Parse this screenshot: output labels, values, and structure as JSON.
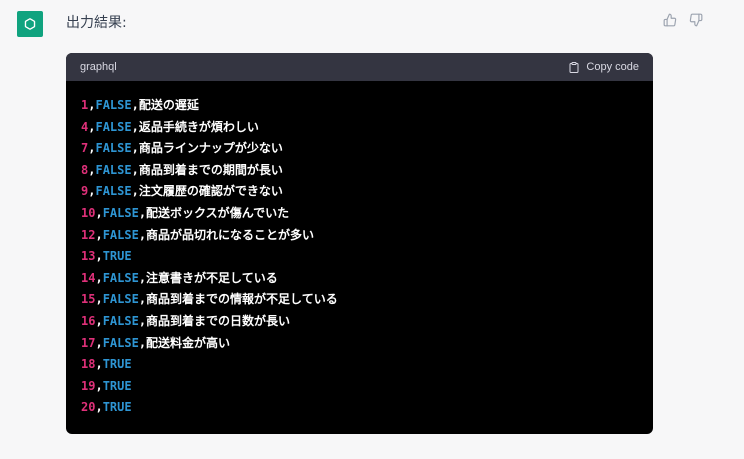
{
  "message": {
    "intro": "出力結果:"
  },
  "code_block": {
    "language": "graphql",
    "copy_label": "Copy code",
    "lines": [
      {
        "num": "1",
        "bool": "FALSE",
        "text": "配送の遅延"
      },
      {
        "num": "4",
        "bool": "FALSE",
        "text": "返品手続きが煩わしい"
      },
      {
        "num": "7",
        "bool": "FALSE",
        "text": "商品ラインナップが少ない"
      },
      {
        "num": "8",
        "bool": "FALSE",
        "text": "商品到着までの期間が長い"
      },
      {
        "num": "9",
        "bool": "FALSE",
        "text": "注文履歴の確認ができない"
      },
      {
        "num": "10",
        "bool": "FALSE",
        "text": "配送ボックスが傷んでいた"
      },
      {
        "num": "12",
        "bool": "FALSE",
        "text": "商品が品切れになることが多い"
      },
      {
        "num": "13",
        "bool": "TRUE",
        "text": ""
      },
      {
        "num": "14",
        "bool": "FALSE",
        "text": "注意書きが不足している"
      },
      {
        "num": "15",
        "bool": "FALSE",
        "text": "商品到着までの情報が不足している"
      },
      {
        "num": "16",
        "bool": "FALSE",
        "text": "商品到着までの日数が長い"
      },
      {
        "num": "17",
        "bool": "FALSE",
        "text": "配送料金が高い"
      },
      {
        "num": "18",
        "bool": "TRUE",
        "text": ""
      },
      {
        "num": "19",
        "bool": "TRUE",
        "text": ""
      },
      {
        "num": "20",
        "bool": "TRUE",
        "text": ""
      }
    ]
  },
  "colors": {
    "avatar": "#10a37f",
    "number": "#df3079",
    "boolean": "#2e95d3",
    "code_background": "#000000",
    "header_background": "#343541"
  },
  "icons": {
    "avatar": "openai-logo-icon",
    "thumbs_up": "thumbs-up-icon",
    "thumbs_down": "thumbs-down-icon",
    "copy": "clipboard-icon"
  }
}
